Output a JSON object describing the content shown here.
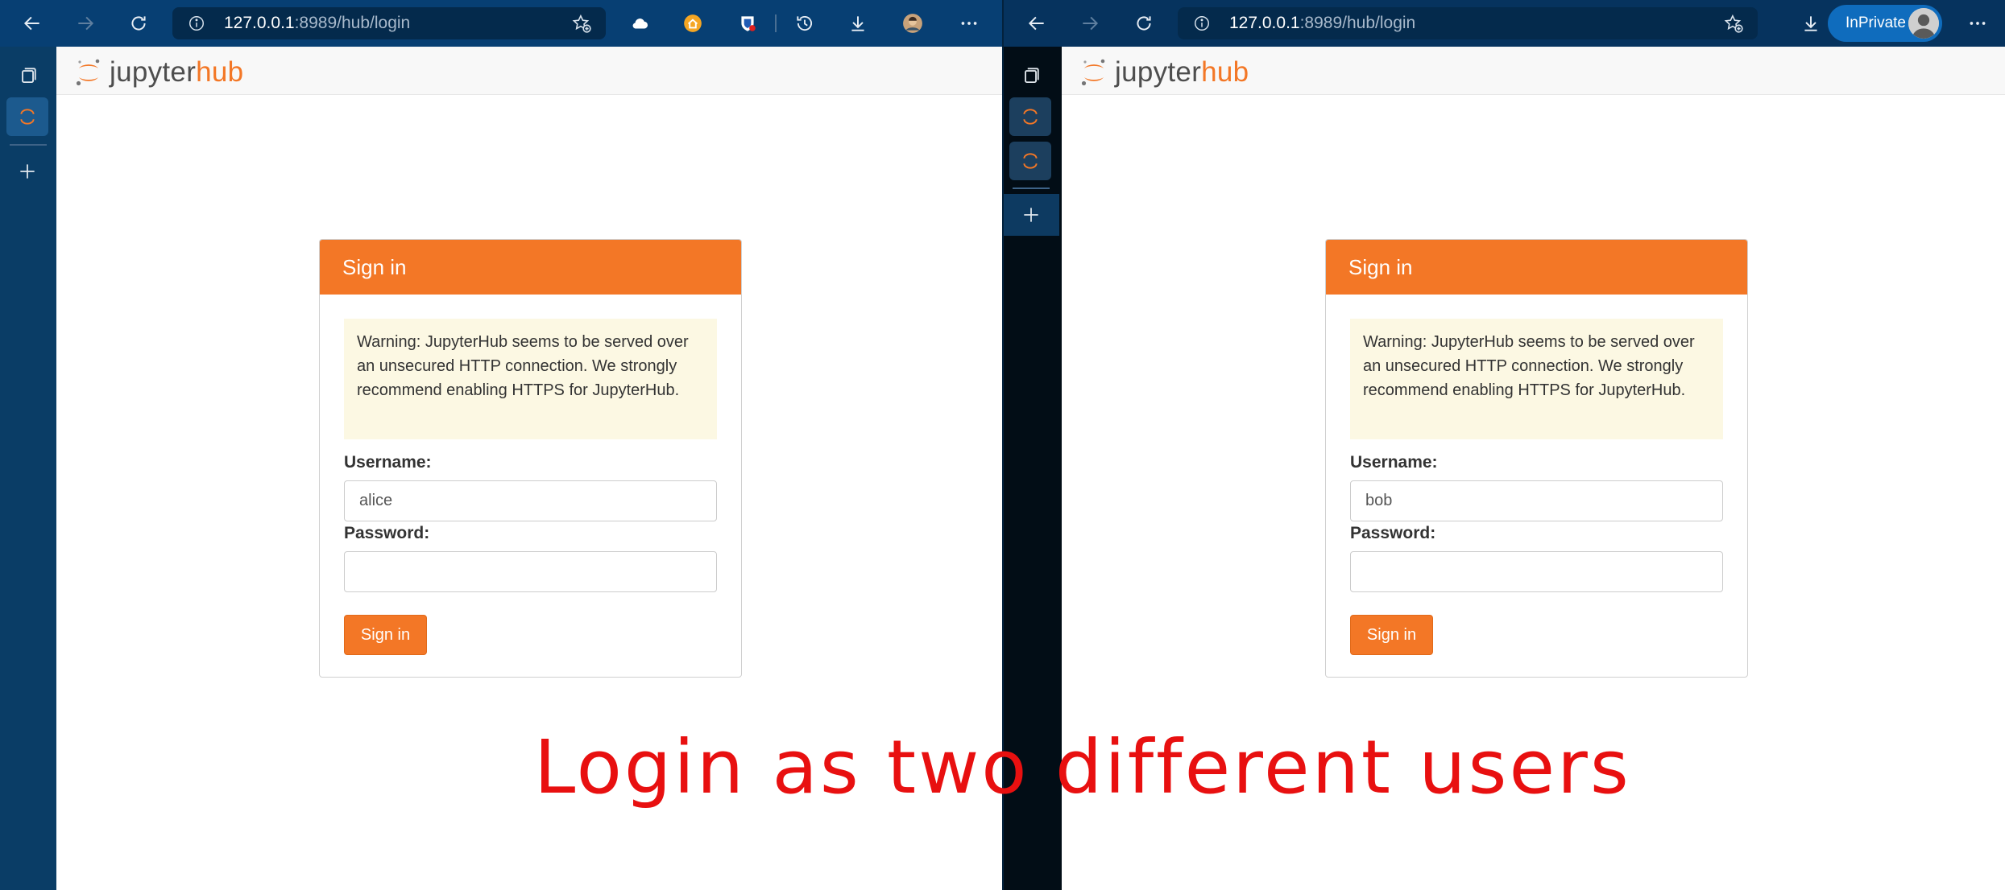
{
  "left_window": {
    "address": {
      "host": "127.0.0.1",
      "rest": ":8989/hub/login"
    },
    "toolbar_icons": [
      "back-icon",
      "forward-icon",
      "refresh-icon",
      "site-info-icon",
      "add-favorite-icon",
      "cloud-extension-icon",
      "home-extension-icon",
      "shield-extension-icon",
      "history-icon",
      "downloads-icon",
      "profile-avatar",
      "more-icon"
    ],
    "logo": {
      "jupyter": "jupyter",
      "hub": "hub"
    },
    "signin": {
      "header": "Sign in",
      "warning": "Warning: JupyterHub seems to be served over an unsecured HTTP connection. We strongly recommend enabling HTTPS for JupyterHub.",
      "username_label": "Username:",
      "username_value": "alice",
      "password_label": "Password:",
      "password_value": "",
      "button": "Sign in"
    }
  },
  "right_window": {
    "address": {
      "host": "127.0.0.1",
      "rest": ":8989/hub/login"
    },
    "inprivate_label": "InPrivate",
    "toolbar_icons": [
      "back-icon",
      "forward-icon",
      "refresh-icon",
      "site-info-icon",
      "add-favorite-icon",
      "downloads-icon",
      "inprivate-avatar",
      "more-icon"
    ],
    "logo": {
      "jupyter": "jupyter",
      "hub": "hub"
    },
    "signin": {
      "header": "Sign in",
      "warning": "Warning: JupyterHub seems to be served over an unsecured HTTP connection. We strongly recommend enabling HTTPS for JupyterHub.",
      "username_label": "Username:",
      "username_value": "bob",
      "password_label": "Password:",
      "password_value": "",
      "button": "Sign in"
    }
  },
  "caption": "Login as two different users",
  "colors": {
    "jupyter_orange": "#f37726",
    "caption_red": "#e81010",
    "toolbar_blue": "#073f73",
    "warning_bg": "#fcf8e3"
  }
}
